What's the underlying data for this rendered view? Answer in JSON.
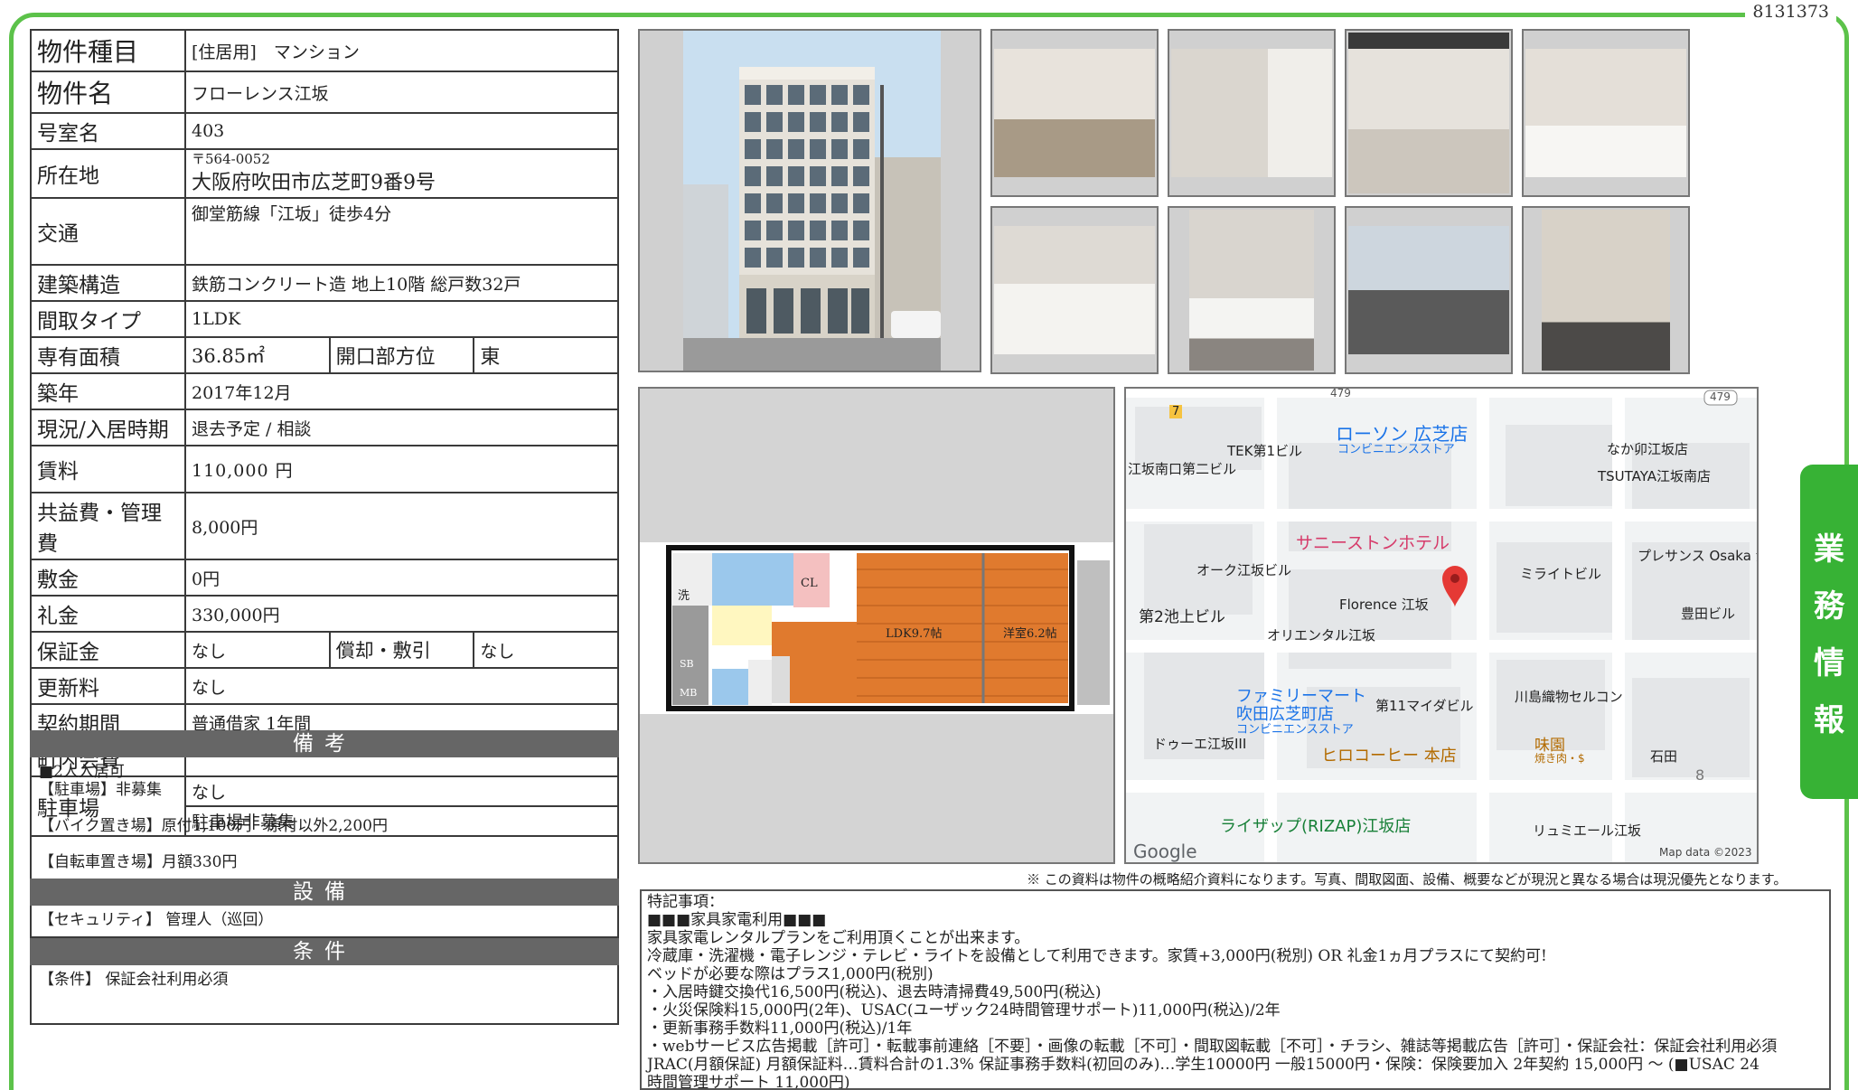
{
  "doc_id": "8131373",
  "property": {
    "type_label": "物件種目",
    "type_value": "[住居用]　マンション",
    "name_label": "物件名",
    "name_value": "フローレンス江坂",
    "room_label": "号室名",
    "room_value": "403",
    "address_label": "所在地",
    "postal": "〒564-0052",
    "address_value": "大阪府吹田市広芝町9番9号",
    "transport_label": "交通",
    "transport_value": "御堂筋線「江坂」徒歩4分",
    "structure_label": "建築構造",
    "structure_value": "鉄筋コンクリート造 地上10階 総戸数32戸",
    "layout_label": "間取タイプ",
    "layout_value": "1LDK",
    "area_label": "専有面積",
    "area_value": "36.85㎡",
    "direction_label": "開口部方位",
    "direction_value": "東",
    "built_label": "築年",
    "built_value": "2017年12月",
    "status_label": "現況/入居時期",
    "status_value": "退去予定 / 相談",
    "rent_label": "賃料",
    "rent_value": "110,000 円",
    "fee_label": "共益費・管理費",
    "fee_value": "8,000円",
    "deposit_label": "敷金",
    "deposit_value": "0円",
    "key_money_label": "礼金",
    "key_money_value": "330,000円",
    "guarantee_label": "保証金",
    "guarantee_value": "なし",
    "amort_label": "償却・敷引",
    "amort_value": "なし",
    "renewal_label": "更新料",
    "renewal_value": "なし",
    "contract_label": "契約期間",
    "contract_value": "普通借家 1年間",
    "community_label": "町内会費",
    "community_value": "",
    "parking_label": "駐車場",
    "parking_value1": "なし",
    "parking_value2": "駐車場非募集"
  },
  "remarks": {
    "title": "備考",
    "lines": [
      "■2人入居可",
      "【駐車場】非募集",
      "",
      "【バイク置き場】原付1,100円　原付以外2,200円",
      "",
      "【自転車置き場】月額330円"
    ]
  },
  "equipment": {
    "title": "設備",
    "text": "【セキュリティ】 管理人（巡回）"
  },
  "conditions": {
    "title": "条件",
    "text": "【条件】 保証会社利用必須"
  },
  "floorplan": {
    "ldk_label": "LDK9.7帖",
    "room_label": "洋室6.2帖",
    "cl": "CL",
    "wash": "洗",
    "sb": "SB",
    "mb": "MB"
  },
  "map": {
    "labels": [
      "TEK第1ビル",
      "江坂南口第二ビル",
      "ローソン 広芝店",
      "コンビニエンスストア",
      "なか卯江坂店",
      "TSUTAYA江坂南店",
      "サニーストンホテル",
      "プレサンス Osaka 江",
      "オーク江坂ビル",
      "ミライトビル",
      "Florence 江坂",
      "豊田ビル",
      "第2池上ビル",
      "オリエンタル江坂",
      "ファミリーマート",
      "吹田広芝町店",
      "コンビニエンスストア",
      "第11マイダビル",
      "川島織物セルコン",
      "ドゥーエ江坂III",
      "ヒロコーヒー 本店",
      "味園",
      "焼き肉・$",
      "石田",
      "ライザップ(RIZAP)江坂店",
      "リュミエール江坂",
      "Google",
      "Map data ©2023"
    ],
    "route_7": "7",
    "route_479a": "479",
    "route_479b": "479",
    "block_8": "8"
  },
  "disclaimer": "※ この資料は物件の概略紹介資料になります。写真、間取図面、設備、概要などが現況と異なる場合は現況優先となります。",
  "special_notes": [
    "特記事項：",
    "■■■家具家電利用■■■",
    "家具家電レンタルプランをご利用頂くことが出来ます。",
    "冷蔵庫・洗濯機・電子レンジ・テレビ・ライトを設備として利用できます。家賃+3,000円(税別) OR 礼金1ヵ月プラスにて契約可!",
    "ベッドが必要な際はプラス1,000円(税別)",
    "・入居時鍵交換代16,500円(税込)、退去時清掃費49,500円(税込)",
    "・火災保険料15,000円(2年)、USAC(ユーザック24時間管理サポート)11,000円(税込)/2年",
    "・更新事務手数料11,000円(税込)/1年",
    "・webサービス広告掲載［許可］・転載事前連絡［不要］・画像の転載［不可］・間取図転載［不可］・チラシ、雑誌等掲載広告［許可］・保証会社：保証会社利用必須",
    " JRAC(月額保証) 月額保証料…賃料合計の1.3% 保証事務手数料(初回のみ)…学生10000円 一般15000円・保険：保険要加入 2年契約 15,000円 〜 (■USAC 24",
    "時間管理サポート 11,000円)"
  ],
  "side_tab": [
    "業",
    "務",
    "情",
    "報"
  ]
}
